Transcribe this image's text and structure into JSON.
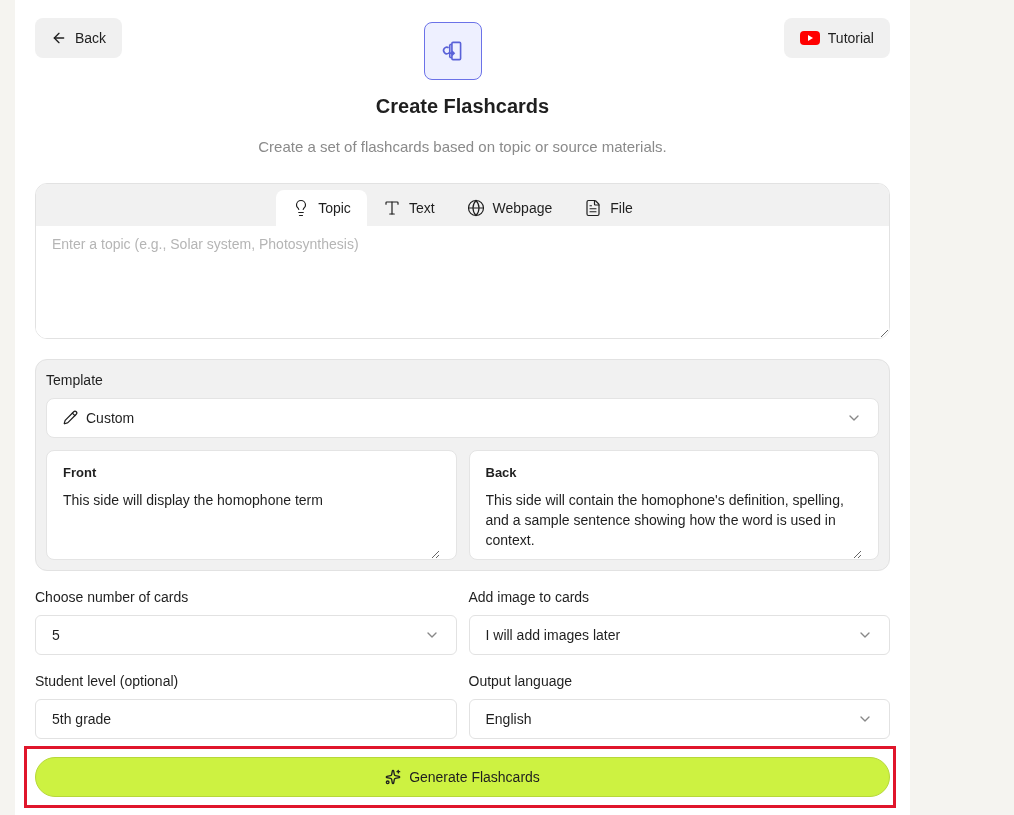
{
  "header": {
    "back": "Back",
    "tutorial": "Tutorial",
    "title": "Create Flashcards",
    "subtitle": "Create a set of flashcards based on topic or source materials."
  },
  "tabs": [
    {
      "kind": "bulb",
      "label": "Topic",
      "selected": true
    },
    {
      "kind": "type",
      "label": "Text",
      "selected": false
    },
    {
      "kind": "globe",
      "label": "Webpage",
      "selected": false
    },
    {
      "kind": "file",
      "label": "File",
      "selected": false
    }
  ],
  "topic": {
    "placeholder": "Enter a topic (e.g., Solar system, Photosynthesis)"
  },
  "template": {
    "label": "Template",
    "value": "Custom",
    "front": {
      "label": "Front",
      "value": "This side will display the homophone term"
    },
    "back": {
      "label": "Back",
      "value": "This side will contain the homophone's definition, spelling, and a sample sentence showing how the word is used in context."
    }
  },
  "fields": [
    {
      "kind": "select",
      "label": "Choose number of cards",
      "value": "5"
    },
    {
      "kind": "select",
      "label": "Add image to cards",
      "value": "I will add images later"
    },
    {
      "kind": "input",
      "label": "Student level (optional)",
      "value": "5th grade"
    },
    {
      "kind": "select",
      "label": "Output language",
      "value": "English"
    }
  ],
  "generate": {
    "label": "Generate Flashcards",
    "highlighted": true
  }
}
